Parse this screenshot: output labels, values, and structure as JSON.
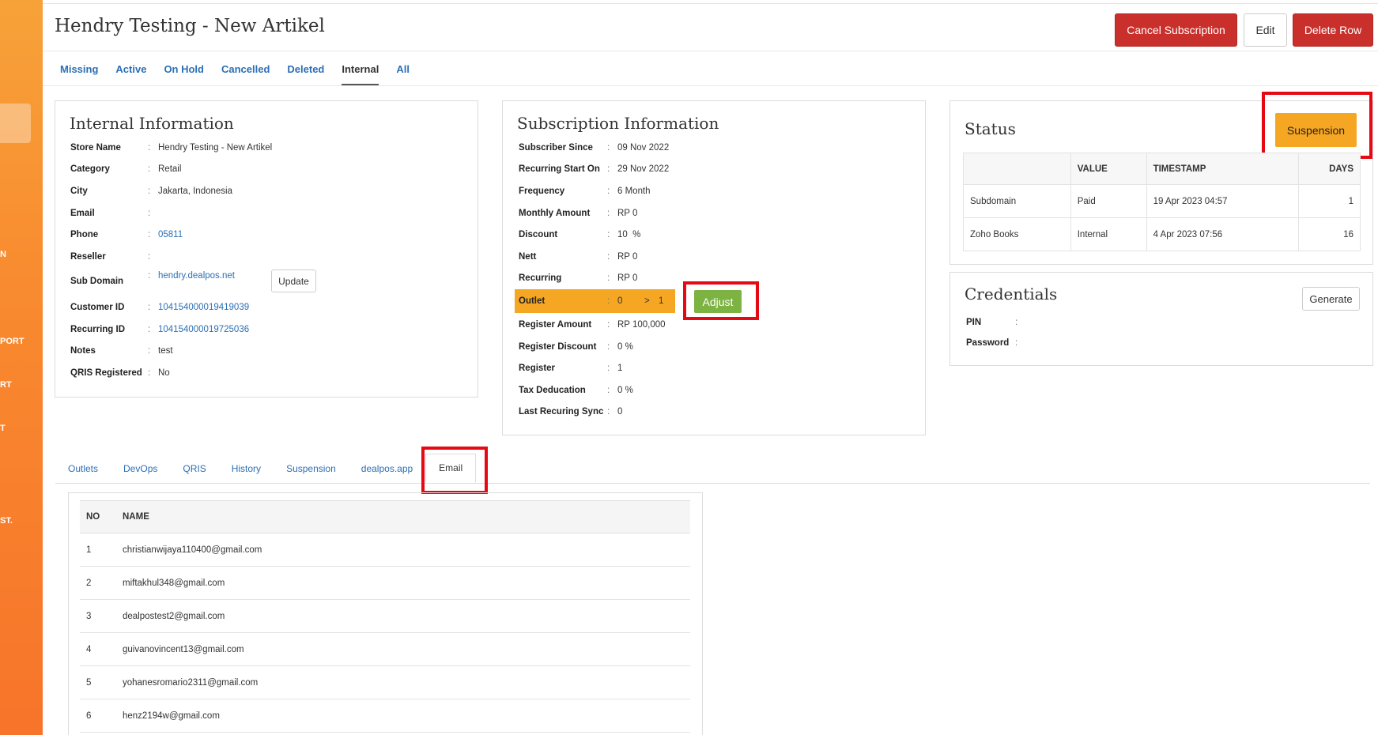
{
  "sidebar": {
    "labels": [
      "N",
      "PORT",
      "RT",
      "T",
      "ST."
    ]
  },
  "header": {
    "title": "Hendry Testing - New Artikel",
    "cancel_label": "Cancel Subscription",
    "edit_label": "Edit",
    "delete_label": "Delete Row"
  },
  "top_tabs": [
    "Missing",
    "Active",
    "On Hold",
    "Cancelled",
    "Deleted",
    "Internal",
    "All"
  ],
  "internal": {
    "title": "Internal Information",
    "update_label": "Update",
    "rows": [
      {
        "label": "Store Name",
        "value": "Hendry Testing - New Artikel"
      },
      {
        "label": "Category",
        "value": "Retail"
      },
      {
        "label": "City",
        "value": "Jakarta, Indonesia"
      },
      {
        "label": "Email",
        "value": ""
      },
      {
        "label": "Phone",
        "value": "05811"
      },
      {
        "label": "Reseller",
        "value": ""
      },
      {
        "label": "Sub Domain",
        "value": "hendry.dealpos.net"
      },
      {
        "label": "Customer ID",
        "value": "104154000019419039"
      },
      {
        "label": "Recurring ID",
        "value": "104154000019725036"
      },
      {
        "label": "Notes",
        "value": "test"
      },
      {
        "label": "QRIS Registered",
        "value": "No"
      }
    ]
  },
  "subscription": {
    "title": "Subscription Information",
    "adjust_label": "Adjust",
    "outlet": {
      "label": "Outlet",
      "from": "0",
      "arrow": ">",
      "to": "1"
    },
    "rows": [
      {
        "label": "Subscriber Since",
        "value": "09 Nov 2022"
      },
      {
        "label": "Recurring Start On",
        "value": "29 Nov 2022"
      },
      {
        "label": "Frequency",
        "value": "6 Month"
      },
      {
        "label": "Monthly Amount",
        "value": "RP 0"
      },
      {
        "label": "Discount",
        "value": "10  %"
      },
      {
        "label": "Nett",
        "value": "RP 0"
      },
      {
        "label": "Recurring",
        "value": "RP 0"
      },
      {
        "label": "Register Amount",
        "value": "RP 100,000"
      },
      {
        "label": "Register Discount",
        "value": "0 %"
      },
      {
        "label": "Register",
        "value": "1"
      },
      {
        "label": "Tax Deducation",
        "value": "0 %"
      },
      {
        "label": "Last Recuring Sync",
        "value": "0"
      }
    ]
  },
  "status": {
    "title": "Status",
    "suspension_label": "Suspension",
    "headers": [
      "",
      "VALUE",
      "TIMESTAMP",
      "DAYS"
    ],
    "rows": [
      {
        "name": "Subdomain",
        "value": "Paid",
        "timestamp": "19 Apr 2023 04:57",
        "days": "1"
      },
      {
        "name": "Zoho Books",
        "value": "Internal",
        "timestamp": "4 Apr 2023 07:56",
        "days": "16"
      }
    ]
  },
  "credentials": {
    "title": "Credentials",
    "generate_label": "Generate",
    "pin_label": "PIN",
    "password_label": "Password"
  },
  "bottom_tabs": [
    "Outlets",
    "DevOps",
    "QRIS",
    "History",
    "Suspension",
    "dealpos.app",
    "Email"
  ],
  "emails": {
    "headers": [
      "NO",
      "NAME"
    ],
    "rows": [
      {
        "no": "1",
        "name": "christianwijaya110400@gmail.com"
      },
      {
        "no": "2",
        "name": "miftakhul348@gmail.com"
      },
      {
        "no": "3",
        "name": "dealpostest2@gmail.com"
      },
      {
        "no": "4",
        "name": "guivanovincent13@gmail.com"
      },
      {
        "no": "5",
        "name": "yohanesromario2311@gmail.com"
      },
      {
        "no": "6",
        "name": "henz2194w@gmail.com"
      }
    ]
  },
  "colors": {
    "accent_orange": "#f5a623",
    "danger_red": "#c9302c",
    "link_blue": "#2b6fb5",
    "success_green": "#7cb342",
    "highlight_red": "#e50914"
  }
}
